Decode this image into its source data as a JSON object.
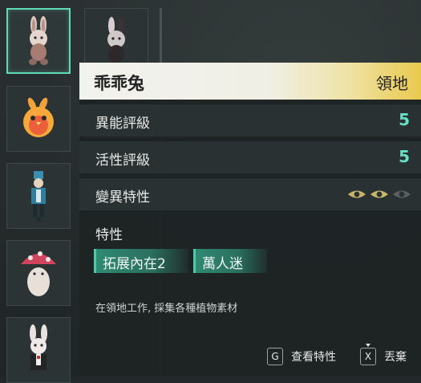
{
  "inventory": {
    "slots": [
      {
        "name": "bunny-doll-beige"
      },
      {
        "name": "bunny-doll-dark"
      },
      {
        "name": "orange-bird-creature"
      },
      {
        "name": "toy-soldier-figure"
      },
      {
        "name": "mushroom-creature"
      },
      {
        "name": "white-rabbit-suit"
      }
    ]
  },
  "panel": {
    "title": "乖乖兔",
    "tag": "領地",
    "rows": [
      {
        "label": "異能評級",
        "value": "5"
      },
      {
        "label": "活性評級",
        "value": "5"
      },
      {
        "label": "變異特性",
        "value": ""
      }
    ],
    "mutation_eyes": {
      "filled": 2,
      "total": 3
    },
    "traits_title": "特性",
    "traits": [
      "拓展內在2",
      "萬人迷"
    ],
    "description": "在領地工作, 採集各種植物素材"
  },
  "footer": {
    "view_key": "G",
    "view_label": "查看特性",
    "discard_key": "X",
    "discard_label": "丟棄"
  },
  "colors": {
    "accent": "#5fd9b8",
    "value": "#67e1c6",
    "title_gold": "#e9c94e",
    "eye_active": "#c9b56a",
    "eye_inactive": "#5a6060"
  }
}
